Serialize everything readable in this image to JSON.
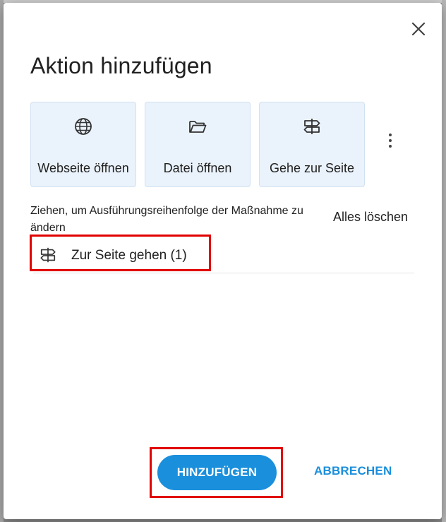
{
  "dialog": {
    "title": "Aktion hinzufügen",
    "close_icon": "close-icon"
  },
  "actions": [
    {
      "label": "Webseite öffnen",
      "icon": "globe-icon"
    },
    {
      "label": "Datei öffnen",
      "icon": "folder-open-icon"
    },
    {
      "label": "Gehe zur Seite",
      "icon": "signpost-icon"
    }
  ],
  "more_icon": "more-vertical-icon",
  "hint": "Ziehen, um Ausführungsreihenfolge der Maßnahme zu ändern",
  "clear_all_label": "Alles löschen",
  "queued_actions": [
    {
      "label": "Zur Seite gehen (1)",
      "icon": "signpost-icon"
    }
  ],
  "footer": {
    "add_label": "HINZUFÜGEN",
    "cancel_label": "ABBRECHEN"
  },
  "colors": {
    "accent": "#1a8fdc",
    "card_background": "#eaf2fb",
    "highlight": "#e10000"
  }
}
